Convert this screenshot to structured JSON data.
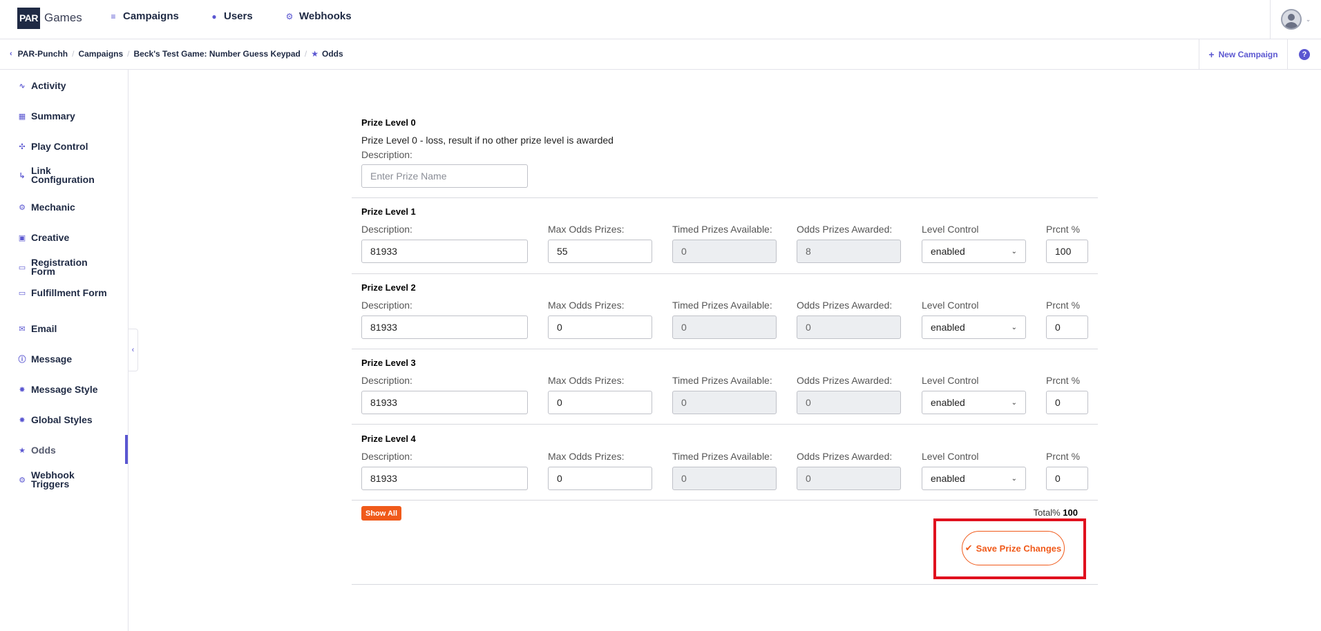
{
  "brand": {
    "logo_mark": "PAR",
    "logo_text": "Games"
  },
  "topnav": {
    "items": [
      {
        "label": "Campaigns",
        "icon": "list-icon"
      },
      {
        "label": "Users",
        "icon": "user-icon"
      },
      {
        "label": "Webhooks",
        "icon": "gear-icon"
      }
    ]
  },
  "breadcrumb": {
    "items": [
      "PAR-Punchh",
      "Campaigns",
      "Beck's Test Game: Number Guess Keypad",
      "Odds"
    ],
    "new_campaign": "New Campaign",
    "help": "?"
  },
  "sidebar": {
    "items": [
      {
        "label": "Activity",
        "icon": "activity-icon"
      },
      {
        "label": "Summary",
        "icon": "dashboard-icon"
      },
      {
        "label": "Play Control",
        "icon": "gamepad-icon"
      },
      {
        "label": "Link Configuration",
        "icon": "link-arrow-icon"
      },
      {
        "label": "Mechanic",
        "icon": "gear-icon"
      },
      {
        "label": "Creative",
        "icon": "image-icon"
      },
      {
        "label": "Registration Form",
        "icon": "form-icon"
      },
      {
        "label": "Fulfillment Form",
        "icon": "form-icon"
      },
      {
        "label": "Email",
        "icon": "mail-icon"
      },
      {
        "label": "Message",
        "icon": "info-icon"
      },
      {
        "label": "Message Style",
        "icon": "palette-icon"
      },
      {
        "label": "Global Styles",
        "icon": "palette-icon"
      },
      {
        "label": "Odds",
        "icon": "star-icon"
      },
      {
        "label": "Webhook Triggers",
        "icon": "gear-icon"
      }
    ],
    "active": "Odds"
  },
  "odds": {
    "level0": {
      "title": "Prize Level 0",
      "subtitle": "Prize Level 0 - loss, result if no other prize level is awarded",
      "description_label": "Description:",
      "description_placeholder": "Enter Prize Name",
      "description_value": ""
    },
    "labels": {
      "description": "Description:",
      "max_odds": "Max Odds Prizes:",
      "timed": "Timed Prizes Available:",
      "awarded": "Odds Prizes Awarded:",
      "level_control": "Level Control",
      "prcnt": "Prcnt %"
    },
    "levels": [
      {
        "title": "Prize Level 1",
        "description": "81933",
        "max_odds": "55",
        "timed": "0",
        "awarded": "8",
        "level_control": "enabled",
        "prcnt": "100"
      },
      {
        "title": "Prize Level 2",
        "description": "81933",
        "max_odds": "0",
        "timed": "0",
        "awarded": "0",
        "level_control": "enabled",
        "prcnt": "0"
      },
      {
        "title": "Prize Level 3",
        "description": "81933",
        "max_odds": "0",
        "timed": "0",
        "awarded": "0",
        "level_control": "enabled",
        "prcnt": "0"
      },
      {
        "title": "Prize Level 4",
        "description": "81933",
        "max_odds": "0",
        "timed": "0",
        "awarded": "0",
        "level_control": "enabled",
        "prcnt": "0"
      }
    ],
    "show_all": "Show All",
    "total_label": "Total%",
    "total_value": "100",
    "save_label": "Save Prize Changes"
  },
  "colors": {
    "accent": "#5b57d1",
    "orange": "#f05a1a",
    "highlight": "#e0101e"
  }
}
